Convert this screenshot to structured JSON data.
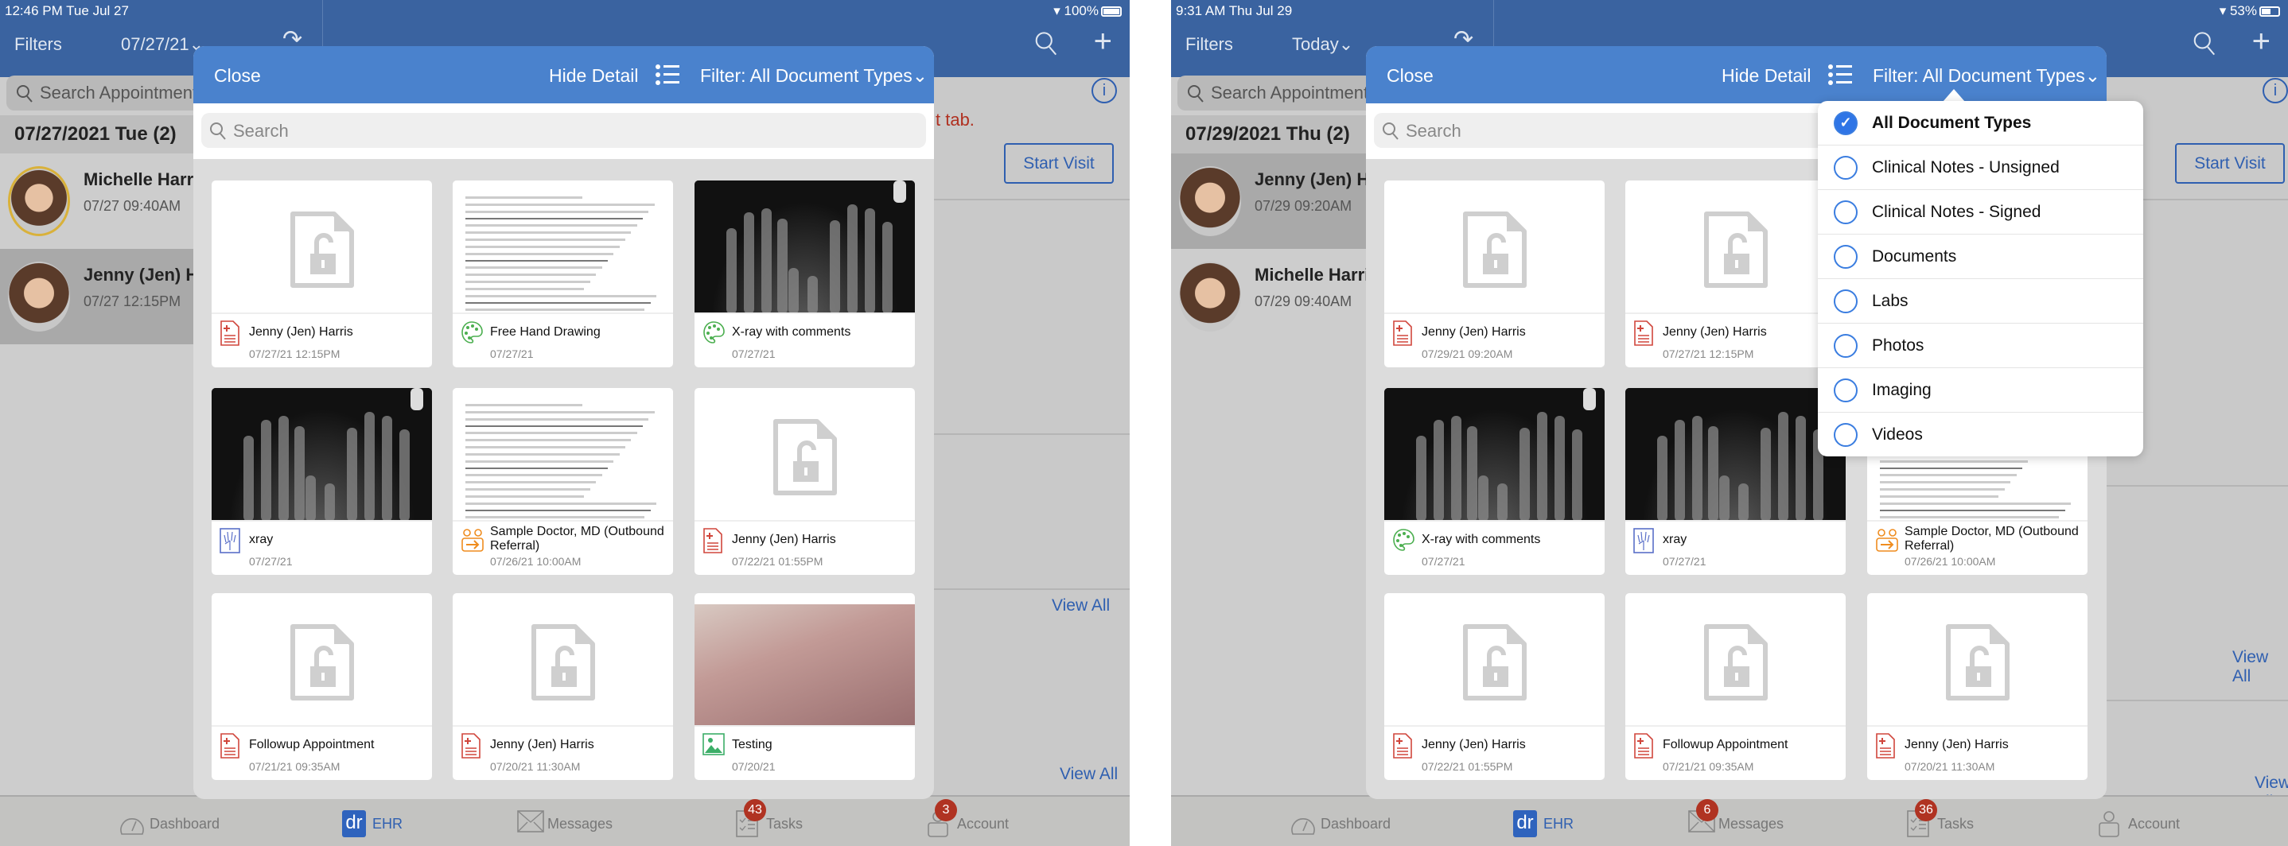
{
  "colors": {
    "header": "#3a63a0",
    "modal_header": "#4a82cd",
    "accent": "#2f5fb0",
    "badge": "#b03322"
  },
  "panels": [
    {
      "status": {
        "time": "12:46 PM   Tue Jul 27",
        "battery": "100%",
        "battery_level": 100
      },
      "header": {
        "filters": "Filters",
        "date": "07/27/21⌄"
      },
      "sidebar": {
        "search_placeholder": "Search Appointments",
        "date_header": "07/27/2021 Tue (2)",
        "patients": [
          {
            "name": "Michelle Harris",
            "time": "07/27 09:40AM",
            "ring": true,
            "selected": false
          },
          {
            "name": "Jenny (Jen) Harris",
            "time": "07/27 12:15PM",
            "ring": false,
            "selected": true
          }
        ]
      },
      "background": {
        "red_text": "t tab.",
        "start_visit": "Start Visit",
        "view_all": [
          "View All",
          "View All"
        ]
      },
      "modal": {
        "close": "Close",
        "hide_detail": "Hide Detail",
        "filter": "Filter: All Document Types⌄",
        "search_placeholder": "Search",
        "cards": [
          {
            "title": "Jenny (Jen) Harris",
            "date": "07/27/21 12:15PM",
            "thumb": "locked-document",
            "icon": "pdf-icon"
          },
          {
            "title": "Free Hand Drawing",
            "date": "07/27/21",
            "thumb": "document",
            "icon": "palette-icon"
          },
          {
            "title": "X-ray with comments",
            "date": "07/27/21",
            "thumb": "xray",
            "icon": "palette-icon"
          },
          {
            "title": "xray",
            "date": "07/27/21",
            "thumb": "xray",
            "icon": "xray-icon"
          },
          {
            "title": "Sample Doctor, MD (Outbound Referral)",
            "date": "07/26/21 10:00AM",
            "thumb": "document",
            "icon": "referral-icon"
          },
          {
            "title": "Jenny (Jen) Harris",
            "date": "07/22/21 01:55PM",
            "thumb": "locked-document",
            "icon": "pdf-icon"
          },
          {
            "title": "Followup Appointment",
            "date": "07/21/21 09:35AM",
            "thumb": "locked-document",
            "icon": "pdf-icon"
          },
          {
            "title": "Jenny (Jen) Harris",
            "date": "07/20/21 11:30AM",
            "thumb": "locked-document",
            "icon": "pdf-icon"
          },
          {
            "title": "Testing",
            "date": "07/20/21",
            "thumb": "photo",
            "icon": "photo-icon"
          }
        ]
      },
      "tabs": [
        {
          "label": "Dashboard",
          "icon": "gauge-icon"
        },
        {
          "label": "EHR",
          "icon": "dr-logo-icon",
          "active": true
        },
        {
          "label": "Messages",
          "icon": "envelope-icon"
        },
        {
          "label": "Tasks",
          "icon": "checklist-icon",
          "badge": "43"
        },
        {
          "label": "Account",
          "icon": "user-icon",
          "badge": "3"
        }
      ]
    },
    {
      "status": {
        "time": "9:31 AM   Thu Jul 29",
        "battery": "53%",
        "battery_level": 53
      },
      "header": {
        "filters": "Filters",
        "date": "Today⌄"
      },
      "sidebar": {
        "search_placeholder": "Search Appointments",
        "date_header": "07/29/2021 Thu (2)",
        "patients": [
          {
            "name": "Jenny (Jen) Harris",
            "time": "07/29 09:20AM",
            "ring": false,
            "selected": true
          },
          {
            "name": "Michelle Harris",
            "time": "07/29 09:40AM",
            "ring": false,
            "selected": false
          }
        ]
      },
      "background": {
        "red_text": "",
        "start_visit": "Start Visit",
        "view_all": [
          "View All",
          "View All"
        ]
      },
      "modal": {
        "close": "Close",
        "hide_detail": "Hide Detail",
        "filter": "Filter: All Document Types⌄",
        "search_placeholder": "Search",
        "cards": [
          {
            "title": "Jenny (Jen) Harris",
            "date": "07/29/21 09:20AM",
            "thumb": "locked-document",
            "icon": "pdf-icon"
          },
          {
            "title": "Jenny (Jen) Harris",
            "date": "07/27/21 12:15PM",
            "thumb": "locked-document",
            "icon": "pdf-icon"
          },
          {
            "title": "",
            "date": "",
            "thumb": "locked-document",
            "icon": ""
          },
          {
            "title": "X-ray with comments",
            "date": "07/27/21",
            "thumb": "xray",
            "icon": "palette-icon"
          },
          {
            "title": "xray",
            "date": "07/27/21",
            "thumb": "xray",
            "icon": "xray-icon"
          },
          {
            "title": "Sample Doctor, MD (Outbound Referral)",
            "date": "07/26/21 10:00AM",
            "thumb": "document",
            "icon": "referral-icon"
          },
          {
            "title": "Jenny (Jen) Harris",
            "date": "07/22/21 01:55PM",
            "thumb": "locked-document",
            "icon": "pdf-icon"
          },
          {
            "title": "Followup Appointment",
            "date": "07/21/21 09:35AM",
            "thumb": "locked-document",
            "icon": "pdf-icon"
          },
          {
            "title": "Jenny (Jen) Harris",
            "date": "07/20/21 11:30AM",
            "thumb": "locked-document",
            "icon": "pdf-icon"
          }
        ],
        "filter_dropdown": {
          "options": [
            {
              "label": "All Document Types",
              "checked": true
            },
            {
              "label": "Clinical Notes - Unsigned"
            },
            {
              "label": "Clinical Notes - Signed"
            },
            {
              "label": "Documents"
            },
            {
              "label": "Labs"
            },
            {
              "label": "Photos"
            },
            {
              "label": "Imaging"
            },
            {
              "label": "Videos"
            }
          ]
        }
      },
      "tabs": [
        {
          "label": "Dashboard",
          "icon": "gauge-icon"
        },
        {
          "label": "EHR",
          "icon": "dr-logo-icon",
          "active": true
        },
        {
          "label": "Messages",
          "icon": "envelope-icon",
          "badge": "6"
        },
        {
          "label": "Tasks",
          "icon": "checklist-icon",
          "badge": "36"
        },
        {
          "label": "Account",
          "icon": "user-icon"
        }
      ]
    }
  ]
}
